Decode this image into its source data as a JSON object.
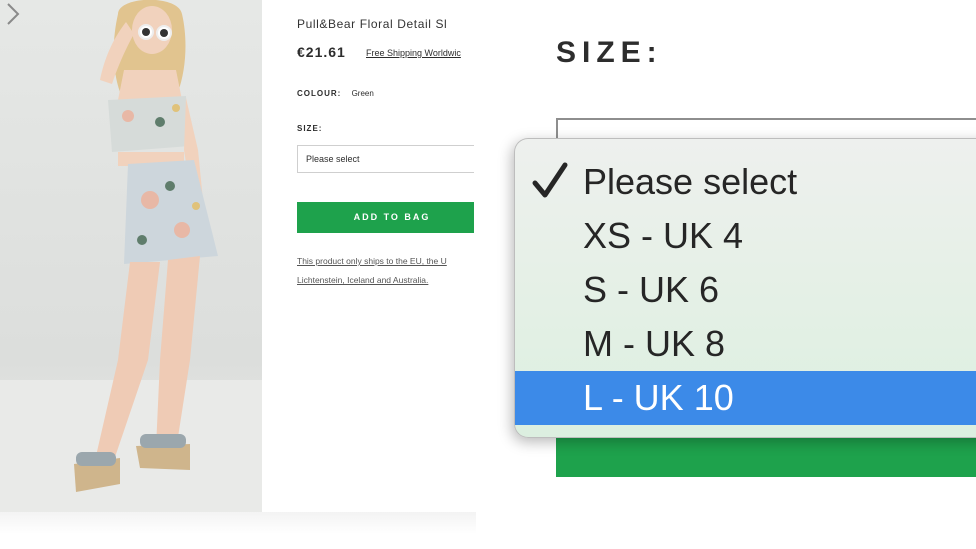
{
  "product": {
    "title": "Pull&Bear Floral Detail Sl",
    "price": "€21.61",
    "shipping_link": "Free Shipping Worldwic",
    "colour_label": "COLOUR:",
    "colour_value": "Green",
    "size_label": "SIZE:",
    "size_select_value": "Please select",
    "add_to_bag_label": "ADD TO BAG",
    "ship_note_line1": "This product only ships to the EU, the U",
    "ship_note_line2": "Lichtenstein, Iceland and Australia."
  },
  "zoom": {
    "size_label": "SIZE:",
    "options": [
      {
        "label": "Please select",
        "checked": true,
        "highlighted": false
      },
      {
        "label": "XS - UK 4",
        "checked": false,
        "highlighted": false
      },
      {
        "label": "S - UK 6",
        "checked": false,
        "highlighted": false
      },
      {
        "label": "M - UK 8",
        "checked": false,
        "highlighted": false
      },
      {
        "label": "L - UK 10",
        "checked": false,
        "highlighted": true
      }
    ]
  },
  "colors": {
    "accent_green": "#1ea24c",
    "highlight_blue": "#3c8ae8"
  },
  "icons": {
    "gallery_next": "chevron-right-icon",
    "checked_option": "checkmark-icon"
  }
}
